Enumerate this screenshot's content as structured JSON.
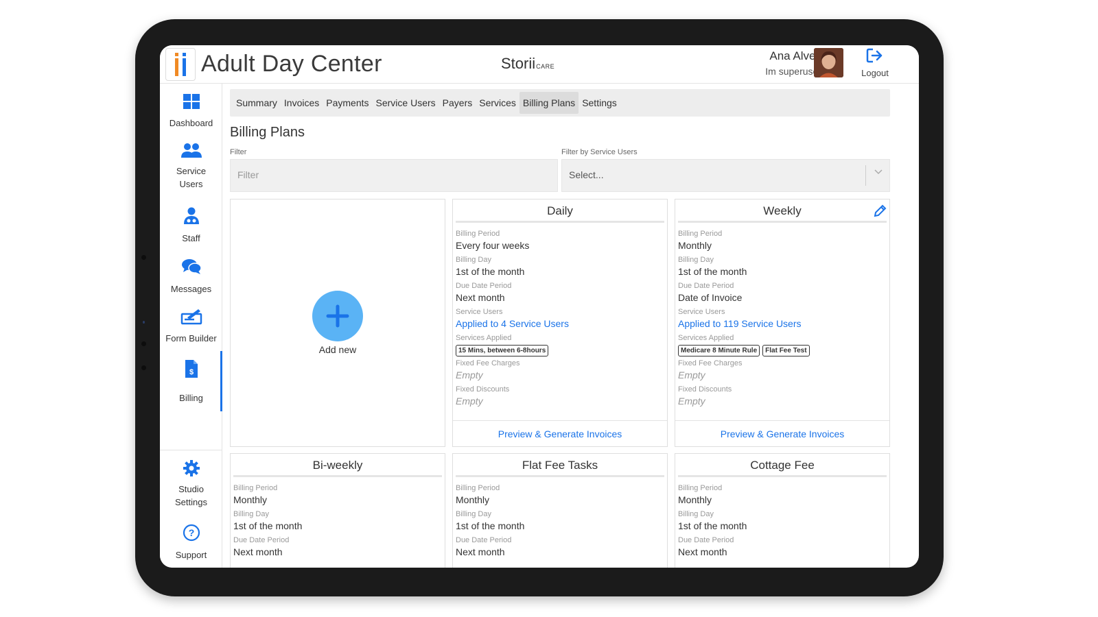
{
  "header": {
    "app_title": "Adult Day Center",
    "brand": "Storii",
    "brand_suffix": "CARE",
    "user_name": "Ana Alves",
    "user_role": "Im superuser",
    "logout_label": "Logout"
  },
  "sidebar": {
    "items": [
      {
        "label": "Dashboard",
        "icon": "dashboard-grid-icon"
      },
      {
        "label": "Service Users",
        "icon": "users-icon"
      },
      {
        "label": "Staff",
        "icon": "staff-icon"
      },
      {
        "label": "Messages",
        "icon": "messages-icon"
      },
      {
        "label": "Form Builder",
        "icon": "form-builder-icon"
      },
      {
        "label": "Billing",
        "icon": "billing-icon"
      },
      {
        "label": "Studio Settings",
        "icon": "gear-icon"
      },
      {
        "label": "Support",
        "icon": "help-icon"
      }
    ],
    "active": "Billing"
  },
  "tabs": [
    "Summary",
    "Invoices",
    "Payments",
    "Service Users",
    "Payers",
    "Services",
    "Billing Plans",
    "Settings"
  ],
  "active_tab": "Billing Plans",
  "page_title": "Billing Plans",
  "filters": {
    "filter_label": "Filter",
    "filter_placeholder": "Filter",
    "service_users_label": "Filter by Service Users",
    "service_users_value": "Select..."
  },
  "add_new_label": "Add new",
  "field_labels": {
    "billing_period": "Billing Period",
    "billing_day": "Billing Day",
    "due_date_period": "Due Date Period",
    "service_users": "Service Users",
    "services_applied": "Services Applied",
    "fixed_fee_charges": "Fixed Fee Charges",
    "fixed_discounts": "Fixed Discounts"
  },
  "preview_label": "Preview & Generate Invoices",
  "plans": [
    {
      "name": "Daily",
      "billing_period": "Every four weeks",
      "billing_day": "1st of the month",
      "due_date_period": "Next month",
      "service_users": "Applied to 4 Service Users",
      "services": [
        "15 Mins, between 6-8hours"
      ],
      "fixed_fee_charges": "Empty",
      "fixed_discounts": "Empty"
    },
    {
      "name": "Weekly",
      "billing_period": "Monthly",
      "billing_day": "1st of the month",
      "due_date_period": "Date of Invoice",
      "service_users": "Applied to 119 Service Users",
      "services": [
        "Medicare 8 Minute Rule",
        "Flat Fee Test"
      ],
      "fixed_fee_charges": "Empty",
      "fixed_discounts": "Empty"
    },
    {
      "name": "Bi-weekly",
      "billing_period": "Monthly",
      "billing_day": "1st of the month",
      "due_date_period": "Next month"
    },
    {
      "name": "Flat Fee Tasks",
      "billing_period": "Monthly",
      "billing_day": "1st of the month",
      "due_date_period": "Next month"
    },
    {
      "name": "Cottage Fee",
      "billing_period": "Monthly",
      "billing_day": "1st of the month",
      "due_date_period": "Next month"
    }
  ],
  "colors": {
    "accent": "#1a73e8",
    "add_button": "#5ab3f5",
    "logo_orange": "#f08a24",
    "logo_blue": "#1a73e8"
  }
}
